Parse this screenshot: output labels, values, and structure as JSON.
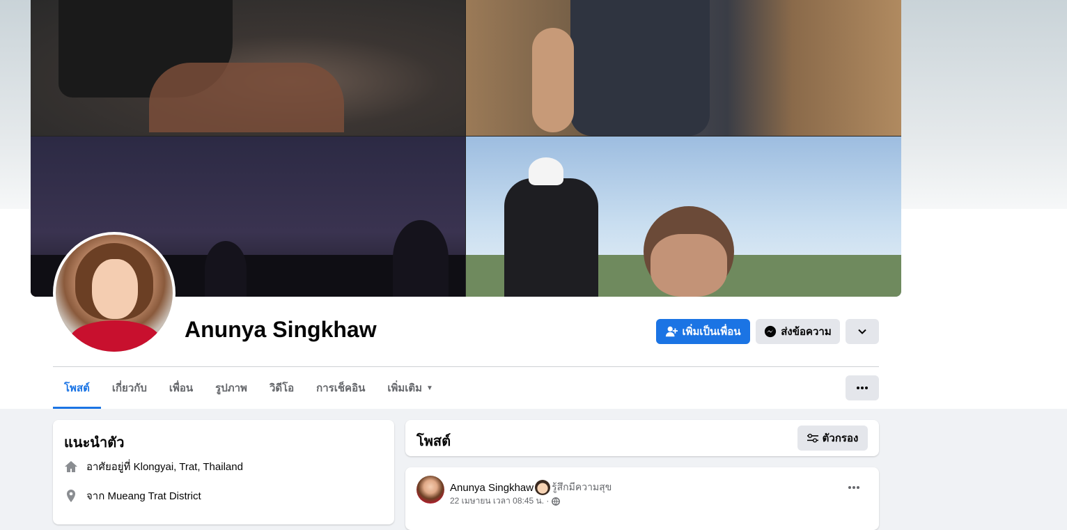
{
  "profile": {
    "name": "Anunya Singkhaw"
  },
  "actions": {
    "add_friend_label": "เพิ่มเป็นเพื่อน",
    "message_label": "ส่งข้อความ"
  },
  "tabs": [
    {
      "label": "โพสต์",
      "active": true
    },
    {
      "label": "เกี่ยวกับ"
    },
    {
      "label": "เพื่อน"
    },
    {
      "label": "รูปภาพ"
    },
    {
      "label": "วิดีโอ"
    },
    {
      "label": "การเช็คอิน"
    },
    {
      "label": "เพิ่มเติม"
    }
  ],
  "intro": {
    "title": "แนะนำตัว",
    "lives_in_prefix": "อาศัยอยู่ที่",
    "lives_in_value": "Klongyai, Trat, Thailand",
    "from_prefix": "จาก",
    "from_value": "Mueang Trat District"
  },
  "posts_header": {
    "title": "โพสต์",
    "filter_label": "ตัวกรอง"
  },
  "post": {
    "author": "Anunya Singkhaw",
    "feeling": "รู้สึกมีความสุข",
    "timestamp": "22 เมษายน เวลา 08:45 น. ·"
  },
  "colors": {
    "accent": "#1b74e4",
    "secondary_button": "#e4e6eb",
    "page_background": "#f0f2f5"
  },
  "icons": {
    "add_friend": "person-plus-icon",
    "message": "messenger-icon",
    "chevron": "chevron-down-icon",
    "more": "more-horizontal-icon",
    "home": "home-icon",
    "location": "location-pin-icon",
    "filter": "filter-sliders-icon",
    "privacy": "globe-icon"
  }
}
